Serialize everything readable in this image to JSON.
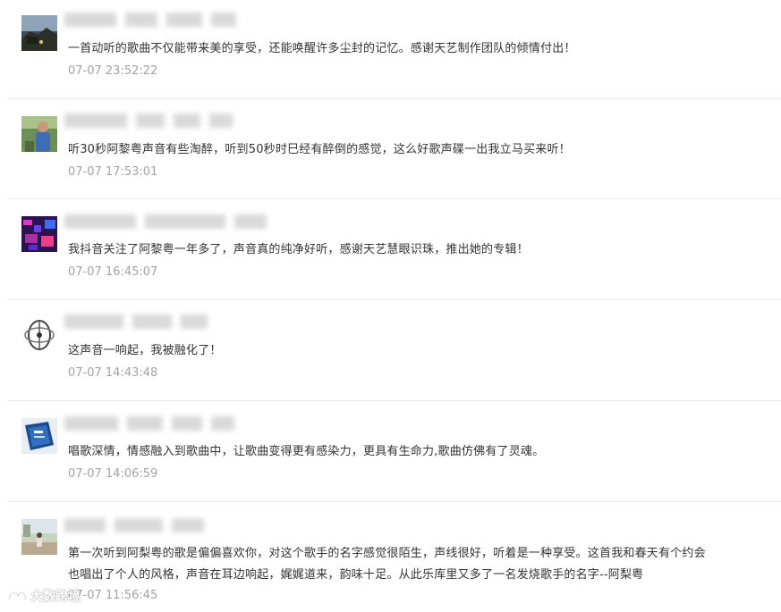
{
  "comments": [
    {
      "text": "一首动听的歌曲不仅能带来美的享受，还能唤醒许多尘封的记忆。感谢天艺制作团队的倾情付出！",
      "time": "07-07 23:52:22",
      "avatar": "night-landscape-avatar"
    },
    {
      "text": "听30秒阿黎粤声音有些淘醉，听到50秒时巳经有醉倒的感觉，这么好歌声碟一出我立马买来听！",
      "time": "07-07 17:53:01",
      "avatar": "man-in-blue-shirt-avatar"
    },
    {
      "text": "我抖音关注了阿黎粤一年多了，声音真的纯净好听，感谢天艺慧眼识珠，推出她的专辑！",
      "time": "07-07 16:45:07",
      "avatar": "purple-lights-avatar"
    },
    {
      "text": "这声音一响起，我被融化了！",
      "time": "07-07 14:43:48",
      "avatar": "gyroscope-avatar"
    },
    {
      "text": "唱歌深情，情感融入到歌曲中，让歌曲变得更有感染力，更具有生命力,歌曲仿佛有了灵魂。",
      "time": "07-07 14:06:59",
      "avatar": "chip-box-avatar"
    },
    {
      "text_line1": "第一次听到阿梨粤的歌是偏偏喜欢你，对这个歌手的名字感觉很陌生，声线很好，听着是一种享受。这首我和春天有个约会",
      "text_line2": "也唱出了个人的风格，声音在耳边响起，娓娓道来，韵味十足。从此乐库里又多了一名发烧歌手的名字--阿梨粤",
      "time": "07-07 11:56:45",
      "avatar": "street-photo-avatar"
    }
  ],
  "watermark": {
    "text": "大数跨境"
  },
  "colors": {
    "text": "#333333",
    "time": "#a3a3a3",
    "divider": "#e6e6e6"
  }
}
